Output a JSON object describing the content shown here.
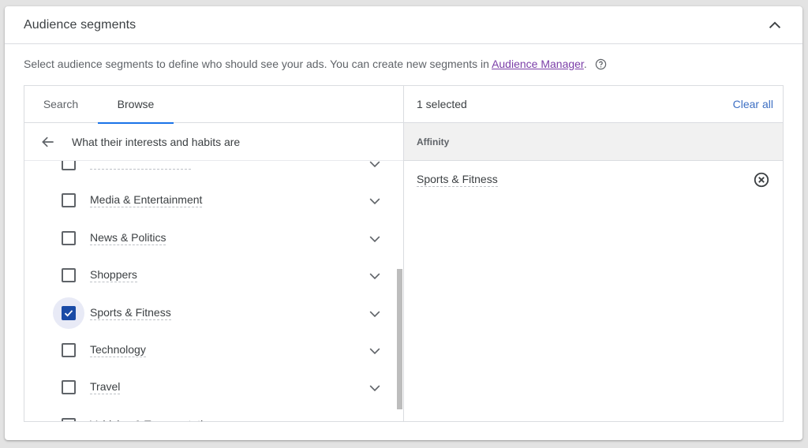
{
  "card": {
    "title": "Audience segments",
    "description_prefix": "Select audience segments to define who should see your ads. You can create new segments in ",
    "description_link": "Audience Manager",
    "description_suffix": "."
  },
  "tabs": [
    {
      "label": "Search",
      "active": false
    },
    {
      "label": "Browse",
      "active": true
    }
  ],
  "browse": {
    "back_label": "What their interests and habits are",
    "items": [
      {
        "label": "",
        "checked": false,
        "clipped": true
      },
      {
        "label": "Media & Entertainment",
        "checked": false
      },
      {
        "label": "News & Politics",
        "checked": false
      },
      {
        "label": "Shoppers",
        "checked": false
      },
      {
        "label": "Sports & Fitness",
        "checked": true
      },
      {
        "label": "Technology",
        "checked": false
      },
      {
        "label": "Travel",
        "checked": false
      },
      {
        "label": "Vehicles & Transportation",
        "checked": false
      }
    ]
  },
  "selection": {
    "count_label": "1 selected",
    "clear_all": "Clear all",
    "group_label": "Affinity",
    "items": [
      {
        "label": "Sports & Fitness"
      }
    ]
  },
  "colors": {
    "accent": "#1a73e8",
    "checkbox_checked": "#1a4ba6",
    "link_visited": "#7b3ea8",
    "clear_all": "#3d6fc3"
  }
}
